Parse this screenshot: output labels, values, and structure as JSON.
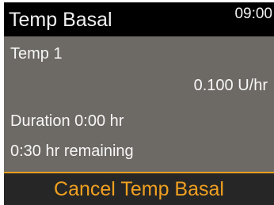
{
  "header": {
    "title": "Temp Basal",
    "time": "09:00"
  },
  "details": {
    "name": "Temp 1",
    "rate": "0.100 U/hr",
    "duration": "Duration 0:00 hr",
    "remaining": "0:30 hr remaining"
  },
  "action": {
    "label": "Cancel Temp Basal"
  },
  "colors": {
    "accent": "#f0a020",
    "content_background": "#6d6965",
    "title_background": "#000000",
    "action_background": "#262626"
  }
}
